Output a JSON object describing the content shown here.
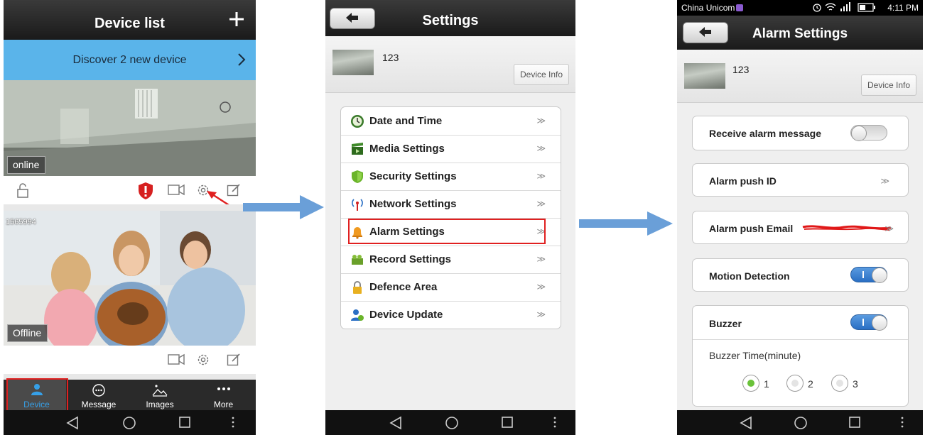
{
  "phone1": {
    "title": "Device list",
    "discover_text": "Discover  2  new device",
    "device1": {
      "status": "online"
    },
    "device2": {
      "id": "1565994",
      "status": "Offline"
    },
    "tabs": [
      {
        "label": "Device",
        "icon": "person-icon"
      },
      {
        "label": "Message",
        "icon": "chat-bubble-icon"
      },
      {
        "label": "Images",
        "icon": "image-icon"
      },
      {
        "label": "More",
        "icon": "more-icon"
      }
    ]
  },
  "phone2": {
    "title": "Settings",
    "device_name": "123",
    "device_info_label": "Device Info",
    "menu": [
      {
        "label": "Date and Time",
        "icon": "clock-icon"
      },
      {
        "label": "Media Settings",
        "icon": "media-icon"
      },
      {
        "label": "Security Settings",
        "icon": "shield-icon"
      },
      {
        "label": "Network Settings",
        "icon": "antenna-icon"
      },
      {
        "label": "Alarm Settings",
        "icon": "bell-icon"
      },
      {
        "label": "Record Settings",
        "icon": "record-icon"
      },
      {
        "label": "Defence Area",
        "icon": "lock-icon"
      },
      {
        "label": "Device Update",
        "icon": "update-icon"
      }
    ],
    "chevron": "≫"
  },
  "phone3": {
    "carrier": "China Unicom",
    "time": "4:11 PM",
    "title": "Alarm Settings",
    "device_name": "123",
    "device_info_label": "Device Info",
    "receive_alarm_label": "Receive alarm message",
    "receive_alarm_on": false,
    "push_id_label": "Alarm push ID",
    "push_email_label": "Alarm push Email",
    "motion_label": "Motion Detection",
    "motion_on": true,
    "buzzer_label": "Buzzer",
    "buzzer_on": true,
    "buzzer_time_label": "Buzzer Time(minute)",
    "buzzer_options": [
      "1",
      "2",
      "3"
    ],
    "buzzer_selected": "1",
    "chevron": "≫"
  },
  "colors": {
    "discover_bg": "#5ab4ea",
    "alert_red": "#e02020",
    "toggle_on": "#2a6fc4",
    "radio_green": "#6ac23a",
    "flow_arrow": "#6a9fd8"
  }
}
